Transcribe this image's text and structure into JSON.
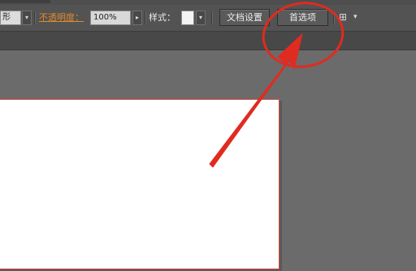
{
  "toolbar": {
    "shape_value": "形",
    "opacity_label": "不透明度：",
    "opacity_value": "100%",
    "style_label": "样式：",
    "doc_settings_button": "文档设置",
    "preferences_button": "首选项",
    "arrange_icon_glyph": "⊞",
    "dropdown_glyph": "▾",
    "arrow_glyph": "▸"
  },
  "colors": {
    "toolbar_bg": "#535353",
    "workspace_bg": "#6b6b6b",
    "opacity_label": "#e08a2a",
    "annotation": "#e02b20"
  },
  "icons": {
    "arrange": "arrange-documents-icon",
    "dropdown": "chevron-down-icon"
  }
}
